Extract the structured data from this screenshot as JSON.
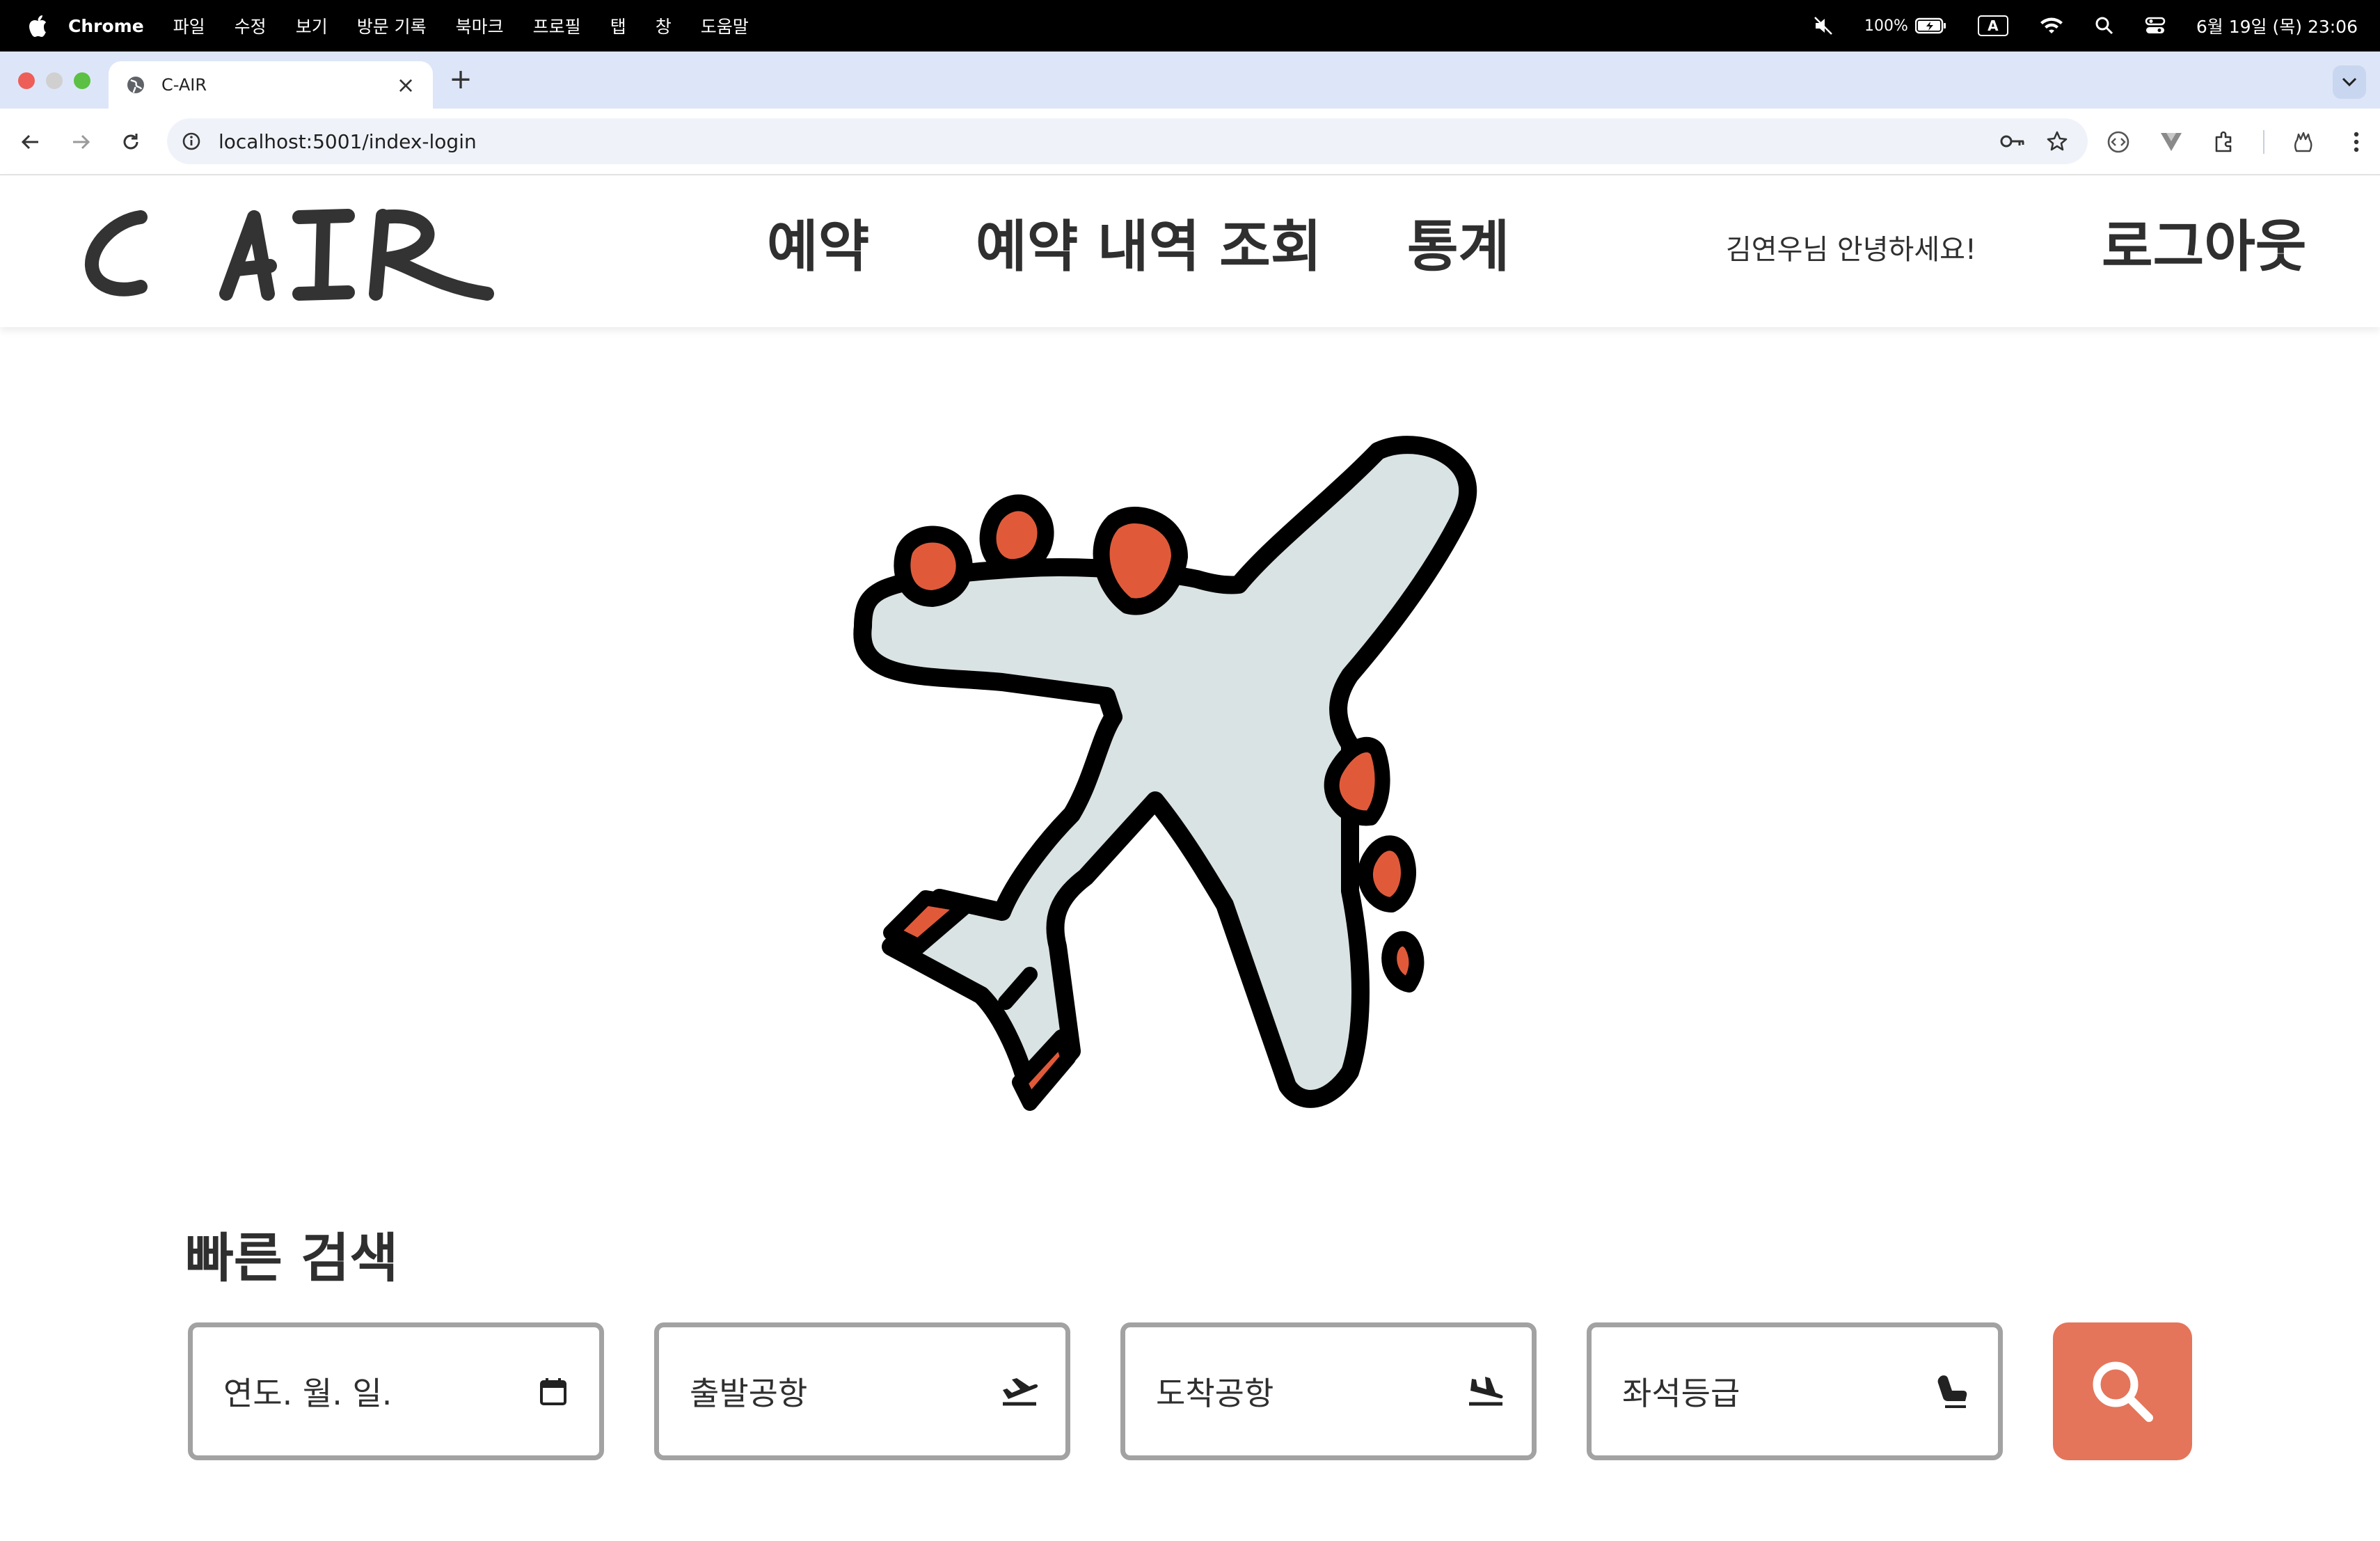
{
  "menubar": {
    "app_name": "Chrome",
    "items": [
      "파일",
      "수정",
      "보기",
      "방문 기록",
      "북마크",
      "프로필",
      "탭",
      "창",
      "도움말"
    ],
    "battery": "100%",
    "input_source": "A",
    "clock": "6월 19일 (목) 23:06"
  },
  "browser": {
    "tab_title": "C-AIR",
    "new_tab": "+",
    "url": "localhost:5001/index-login"
  },
  "site": {
    "logo_text": "C AIR",
    "nav": {
      "reserve": "예약",
      "history": "예약 내역 조회",
      "stats": "통계"
    },
    "greeting": "김연우님 안녕하세요!",
    "logout": "로그아웃"
  },
  "quick_search": {
    "title": "빠른 검색",
    "date_placeholder": "연도. 월. 일.",
    "departure_placeholder": "출발공항",
    "arrival_placeholder": "도착공항",
    "seat_placeholder": "좌석등급"
  },
  "colors": {
    "accent": "#e4755a",
    "plane_body": "#d9e3e3",
    "plane_engine": "#e05a3a",
    "outline": "#000000",
    "field_border": "#a2a2a2"
  },
  "icons": {
    "date": "calendar-icon",
    "departure": "plane-takeoff-icon",
    "arrival": "plane-landing-icon",
    "seat": "seat-icon",
    "search": "search-icon"
  }
}
